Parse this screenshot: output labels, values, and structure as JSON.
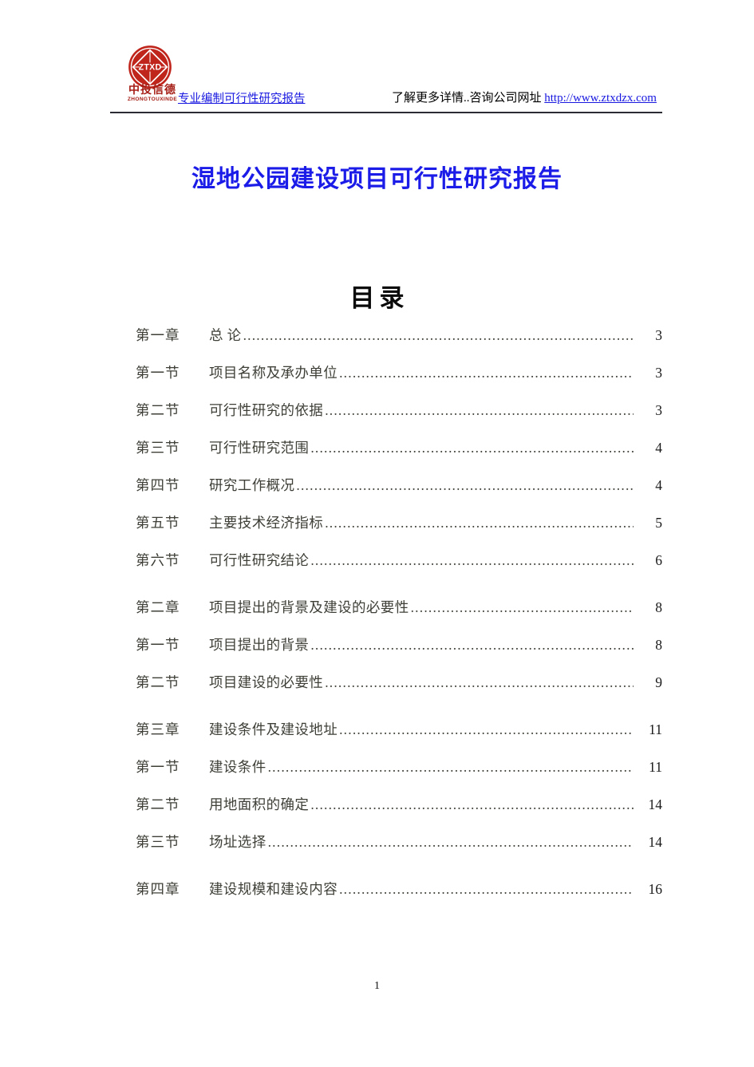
{
  "header": {
    "logo": {
      "mark_text": "ZTXD",
      "company_cn": "中投信德",
      "company_en": "ZHONGTOUXINDE",
      "brand_color": "#c0251c"
    },
    "tagline": "专业编制可行性研究报告",
    "contact_prefix": "了解更多详情..咨询公司网址",
    "url": "http://www.ztxdzx.com",
    "link_color": "#1818e0"
  },
  "title": "湿地公园建设项目可行性研究报告",
  "toc": {
    "heading": "目录",
    "entries": [
      {
        "num": "第一章",
        "label": "总 论 ",
        "page": "3",
        "is_chapter": true
      },
      {
        "num": "第一节",
        "label": "项目名称及承办单位",
        "page": "3",
        "is_chapter": false
      },
      {
        "num": "第二节",
        "label": "可行性研究的依据",
        "page": "3",
        "is_chapter": false
      },
      {
        "num": "第三节",
        "label": "可行性研究范围",
        "page": "4",
        "is_chapter": false
      },
      {
        "num": "第四节",
        "label": "研究工作概况",
        "page": "4",
        "is_chapter": false
      },
      {
        "num": "第五节",
        "label": "主要技术经济指标",
        "page": "5",
        "is_chapter": false
      },
      {
        "num": "第六节",
        "label": "可行性研究结论",
        "page": "6",
        "is_chapter": false
      },
      {
        "num": "第二章",
        "label": "项目提出的背景及建设的必要性",
        "page": "8",
        "is_chapter": true
      },
      {
        "num": "第一节",
        "label": "项目提出的背景",
        "page": "8",
        "is_chapter": false
      },
      {
        "num": "第二节",
        "label": "项目建设的必要性",
        "page": "9",
        "is_chapter": false
      },
      {
        "num": "第三章",
        "label": "建设条件及建设地址",
        "page": "11",
        "is_chapter": true
      },
      {
        "num": "第一节",
        "label": "建设条件",
        "page": "11",
        "is_chapter": false
      },
      {
        "num": "第二节",
        "label": "用地面积的确定",
        "page": "14",
        "is_chapter": false
      },
      {
        "num": "第三节",
        "label": "场址选择",
        "page": "14",
        "is_chapter": false
      },
      {
        "num": "第四章",
        "label": "建设规模和建设内容",
        "page": "16",
        "is_chapter": true
      }
    ]
  },
  "footer": {
    "page_number": "1"
  }
}
